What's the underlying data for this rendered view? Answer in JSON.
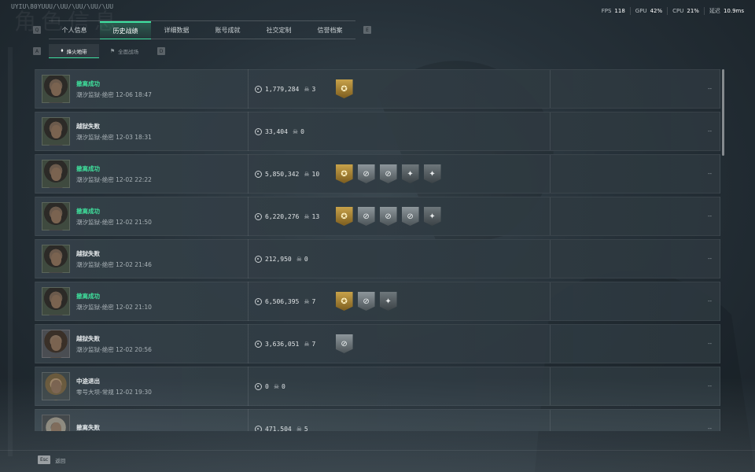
{
  "watermark": "角色信息",
  "top_id": "UYIU\\80YUUU/\\UU/\\UU/\\UU/\\UU",
  "hud": [
    {
      "label": "FPS",
      "value": "118"
    },
    {
      "label": "GPU",
      "value": "42%"
    },
    {
      "label": "CPU",
      "value": "21%"
    },
    {
      "label": "延迟",
      "value": "10.9ms"
    }
  ],
  "key_hints": {
    "left": "Q",
    "right": "E",
    "sub_left": "A",
    "sub_right": "D",
    "esc": "Esc"
  },
  "tabs": [
    {
      "label": "个人信息"
    },
    {
      "label": "历史战绩"
    },
    {
      "label": "详细数据"
    },
    {
      "label": "账号成就"
    },
    {
      "label": "社交定制"
    },
    {
      "label": "信誉档案"
    }
  ],
  "active_tab_index": 1,
  "subtabs": [
    {
      "label": "烽火地带",
      "icon": "map-icon"
    },
    {
      "label": "全面战场",
      "icon": "flag-icon"
    }
  ],
  "matches": [
    {
      "result": "撤离成功",
      "success": true,
      "detail": "潮汐监狱-绝密 12-06 18:47",
      "money": "1,779,284",
      "kills": "3",
      "badges": [
        "gold"
      ],
      "right": "--",
      "avatar": "soldier"
    },
    {
      "result": "越狱失败",
      "success": false,
      "detail": "潮汐监狱-绝密 12-03 18:31",
      "money": "33,404",
      "kills": "0",
      "badges": [],
      "right": "--",
      "avatar": "bald"
    },
    {
      "result": "撤离成功",
      "success": true,
      "detail": "潮汐监狱-绝密 12-02 22:22",
      "money": "5,850,342",
      "kills": "10",
      "badges": [
        "gold",
        "silver",
        "silver",
        "dark",
        "dark"
      ],
      "right": "--",
      "avatar": "bald"
    },
    {
      "result": "撤离成功",
      "success": true,
      "detail": "潮汐监狱-绝密 12-02 21:50",
      "money": "6,220,276",
      "kills": "13",
      "badges": [
        "gold",
        "silver",
        "silver",
        "silver",
        "dark"
      ],
      "right": "--",
      "avatar": "bald"
    },
    {
      "result": "越狱失败",
      "success": false,
      "detail": "潮汐监狱-绝密 12-02 21:46",
      "money": "212,950",
      "kills": "0",
      "badges": [],
      "right": "--",
      "avatar": "bald"
    },
    {
      "result": "撤离成功",
      "success": true,
      "detail": "潮汐监狱-绝密 12-02 21:10",
      "money": "6,506,395",
      "kills": "7",
      "badges": [
        "gold",
        "silver",
        "dark"
      ],
      "right": "--",
      "avatar": "bald"
    },
    {
      "result": "越狱失败",
      "success": false,
      "detail": "潮汐监狱-绝密 12-02 20:56",
      "money": "3,636,051",
      "kills": "7",
      "badges": [
        "silver"
      ],
      "right": "--",
      "avatar": "hair"
    },
    {
      "result": "中途退出",
      "success": false,
      "detail": "零号大坝-常规 12-02 19:30",
      "money": "0",
      "kills": "0",
      "badges": [],
      "right": "--",
      "avatar": "blond"
    },
    {
      "result": "撤离失败",
      "success": false,
      "detail": "",
      "money": "471,504",
      "kills": "5",
      "badges": [],
      "right": "--",
      "avatar": "helm"
    }
  ],
  "badge_glyphs": {
    "gold": "✪",
    "silver": "⊘",
    "dark": "✦"
  },
  "bottom": {
    "back_label": "返回"
  }
}
